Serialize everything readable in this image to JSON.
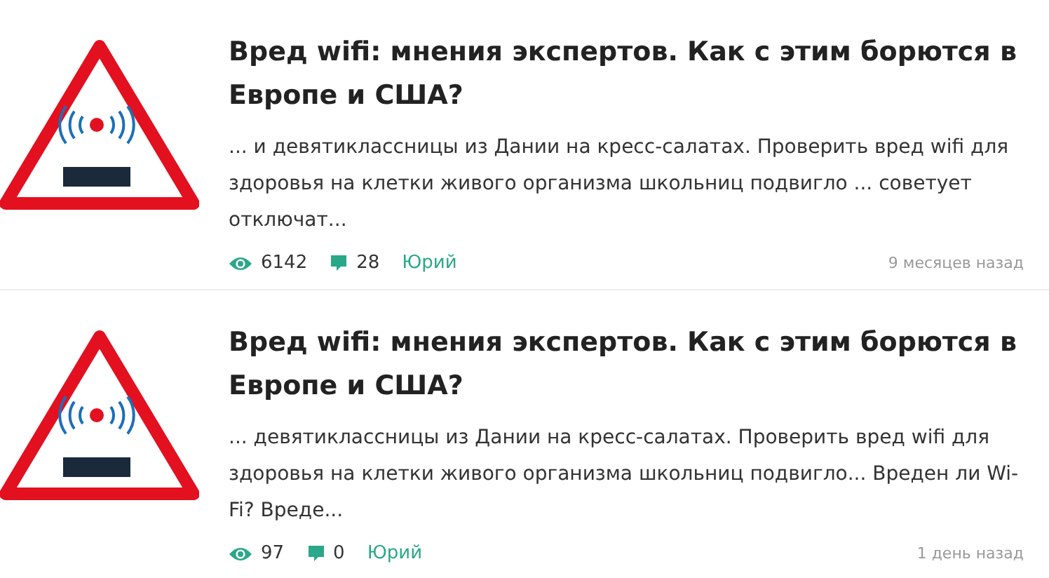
{
  "articles": [
    {
      "title": "Вред wifi: мнения экспертов. Как с этим борются в Европе и США?",
      "excerpt": "... и девятиклассницы из Дании на кресс-салатах. Проверить вред wifi для здоровья на клетки живого организма школьниц подвигло ... советует отключат...",
      "views": "6142",
      "comments": "28",
      "author": "Юрий",
      "date": "9 месяцев назад"
    },
    {
      "title": "Вред wifi: мнения экспертов. Как с этим борются в Европе и США?",
      "excerpt": "... девятиклассницы из Дании на кресс-салатах. Проверить вред wifi для здоровья на клетки живого организма школьниц подвигло... Вреден ли Wi-Fi? Вреде...",
      "views": "97",
      "comments": "0",
      "author": "Юрий",
      "date": "1 день назад"
    }
  ]
}
